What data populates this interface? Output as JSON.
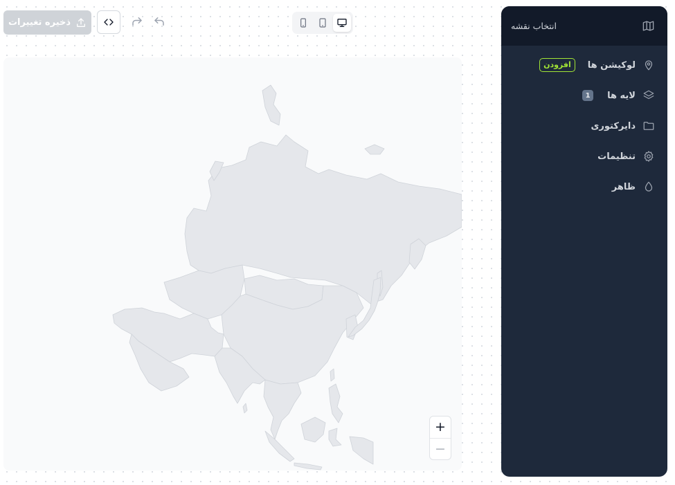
{
  "toolbar": {
    "save_label": "ذخیره تغییرات",
    "save_icon": "upload-icon",
    "code_icon": "code-icon",
    "redo_icon": "redo-icon",
    "undo_icon": "undo-icon",
    "devices": [
      {
        "name": "mobile",
        "icon": "mobile-icon",
        "active": false
      },
      {
        "name": "tablet",
        "icon": "tablet-icon",
        "active": false
      },
      {
        "name": "desktop",
        "icon": "desktop-icon",
        "active": true
      }
    ]
  },
  "map": {
    "region": "Asia",
    "zoom_in_label": "+",
    "zoom_out_label": "−",
    "land_color": "#e5e7eb",
    "border_color": "#cfd3d9"
  },
  "panel": {
    "header_title": "انتخاب نقشه",
    "header_icon": "map-icon",
    "items": [
      {
        "label": "لوکیشن ها",
        "icon": "location-pin-icon",
        "badge": "افزودن"
      },
      {
        "label": "لایه ها",
        "icon": "layers-icon",
        "count": "1"
      },
      {
        "label": "دایرکتوری",
        "icon": "folder-icon"
      },
      {
        "label": "تنظیمات",
        "icon": "gear-icon"
      },
      {
        "label": "ظاهر",
        "icon": "droplet-icon"
      }
    ]
  },
  "colors": {
    "panel_bg": "#1e293b",
    "panel_header_bg": "#121a29",
    "accent_green": "#a3e635",
    "save_disabled": "#cfd3d8"
  }
}
